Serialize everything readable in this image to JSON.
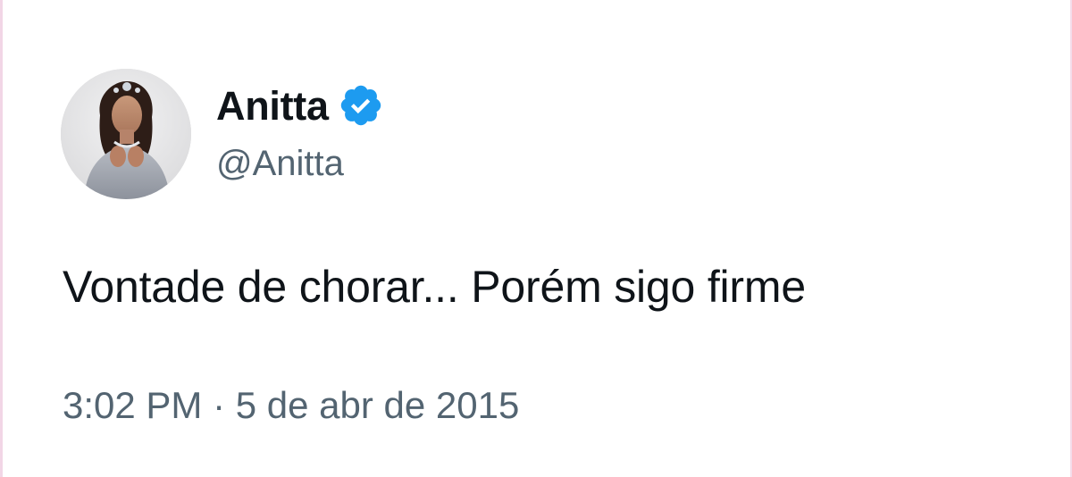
{
  "tweet": {
    "display_name": "Anitta",
    "handle": "@Anitta",
    "verified_icon": "verified-badge-icon",
    "text": "Vontade de chorar... Porém sigo firme",
    "timestamp": "3:02 PM · 5 de abr de 2015",
    "colors": {
      "name": "#0f1419",
      "secondary": "#536471",
      "verified": "#1d9bf0",
      "background": "#ffffff"
    }
  }
}
